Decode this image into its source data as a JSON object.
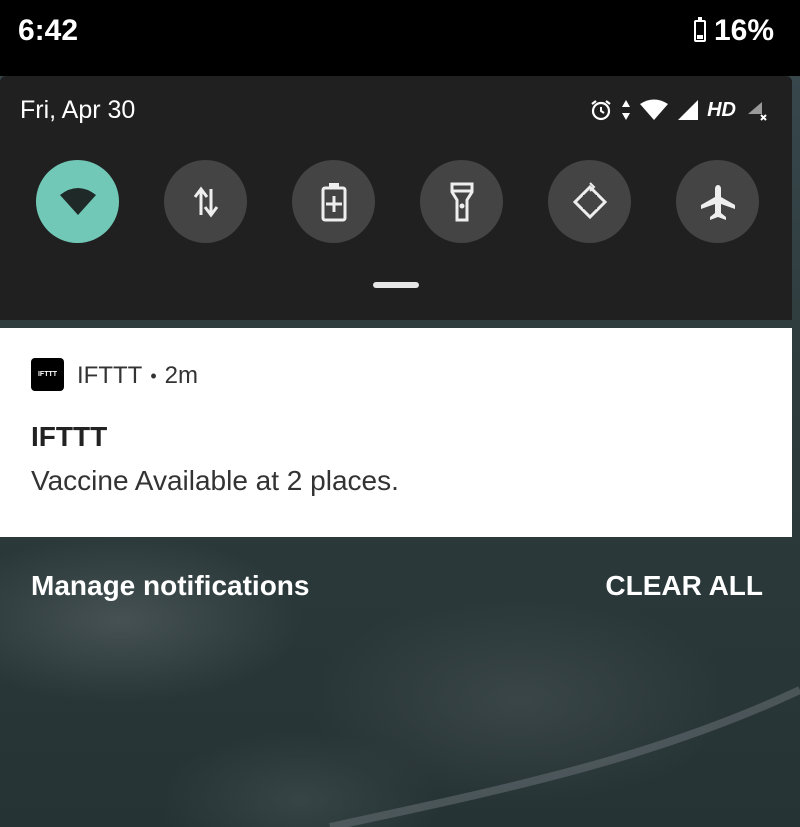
{
  "status_bar": {
    "time": "6:42",
    "battery": "16%"
  },
  "quick_settings": {
    "date": "Fri, Apr 30",
    "network_label": "HD",
    "tiles": [
      {
        "name": "wifi",
        "active": true
      },
      {
        "name": "mobile-data",
        "active": false
      },
      {
        "name": "battery-saver",
        "active": false
      },
      {
        "name": "flashlight",
        "active": false
      },
      {
        "name": "auto-rotate",
        "active": false
      },
      {
        "name": "airplane-mode",
        "active": false
      }
    ]
  },
  "notification": {
    "app_icon_text": "IFTTT",
    "app_name": "IFTTT",
    "time": "2m",
    "title": "IFTTT",
    "text": "Vaccine Available at 2 places."
  },
  "actions": {
    "manage": "Manage notifications",
    "clear_all": "CLEAR ALL"
  },
  "colors": {
    "active_tile": "#72c8b6",
    "inactive_tile": "#444444",
    "panel": "#202020"
  }
}
